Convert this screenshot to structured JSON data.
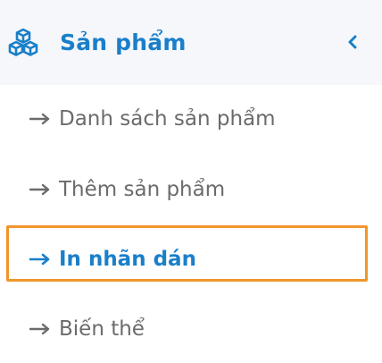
{
  "menu": {
    "title": "Sản phẩm",
    "icon": "cubes-icon",
    "collapse_icon": "chevron-left-icon",
    "accent_color": "#1a7fc9",
    "header_bg": "#f5f7fa",
    "highlight_color": "#f0962a",
    "items": [
      {
        "label": "Danh sách sản phẩm",
        "icon": "arrow-right-icon",
        "active": false
      },
      {
        "label": "Thêm sản phẩm",
        "icon": "arrow-right-icon",
        "active": false
      },
      {
        "label": "In nhãn dán",
        "icon": "arrow-right-icon",
        "active": true
      },
      {
        "label": "Biến thể",
        "icon": "arrow-right-icon",
        "active": false
      }
    ]
  }
}
